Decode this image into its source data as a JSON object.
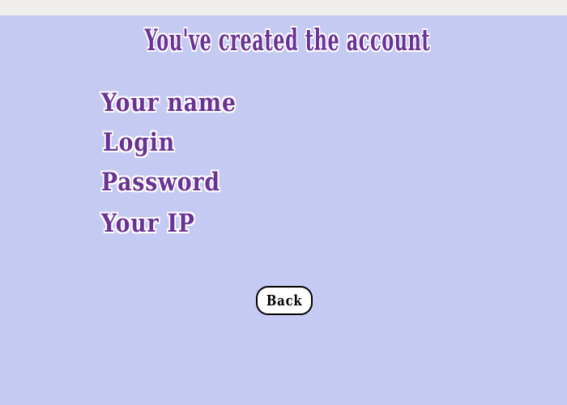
{
  "dialog": {
    "title": "You've created the account",
    "fields": {
      "name_label": "Your name",
      "login_label": "Login",
      "password_label": "Password",
      "ip_label": "Your IP"
    },
    "back_label": "Back"
  },
  "colors": {
    "background": "#c5caf2",
    "text": "#6a3294",
    "top_strip": "#efeeea"
  }
}
